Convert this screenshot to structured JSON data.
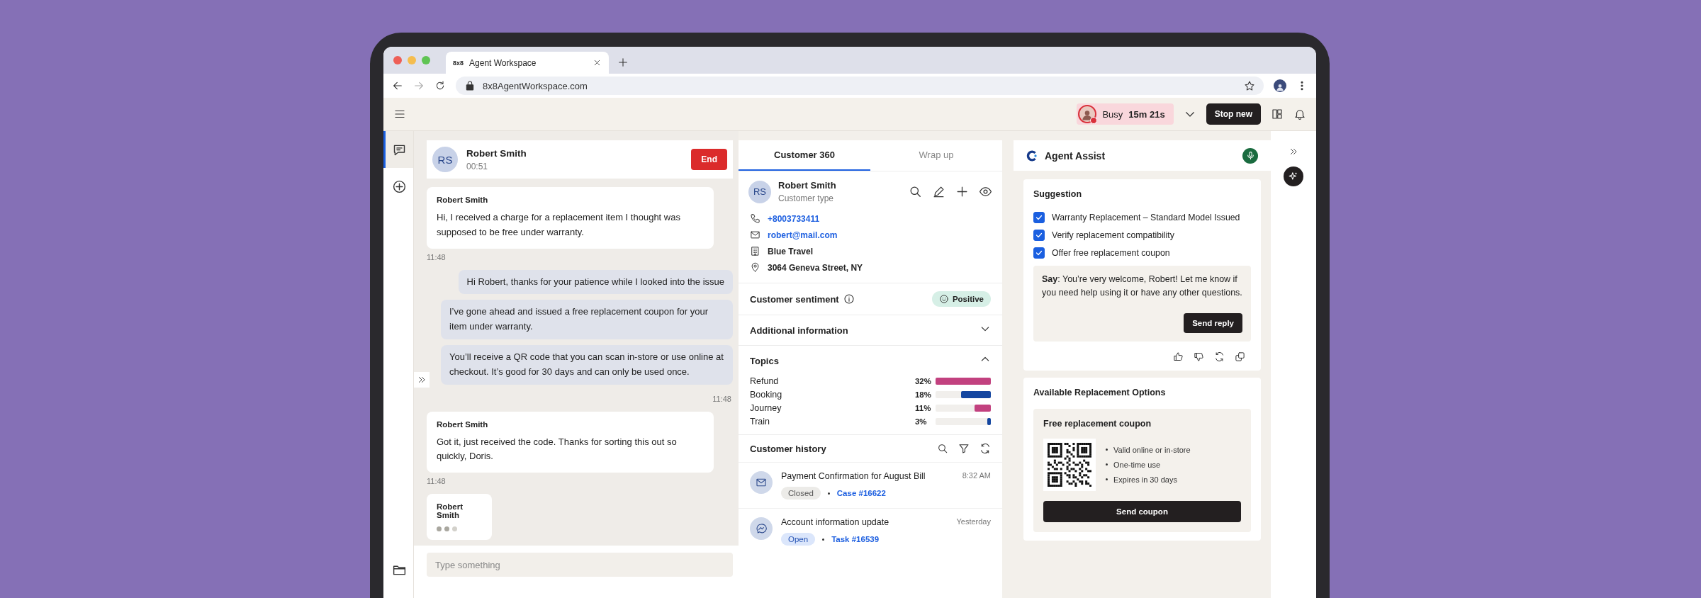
{
  "browser": {
    "tab": {
      "favicon_text": "8x8",
      "title": "Agent Workspace"
    },
    "url": "8x8AgentWorkspace.com"
  },
  "topbar": {
    "status": {
      "label": "Busy",
      "timer": "15m 21s"
    },
    "stop_button": "Stop new"
  },
  "nav": [
    {
      "kind": "chat",
      "selected": true
    },
    {
      "kind": "add",
      "selected": false
    },
    {
      "kind": "folder",
      "selected": false
    }
  ],
  "chat": {
    "contact": {
      "initials": "RS",
      "name": "Robert Smith",
      "duration": "00:51"
    },
    "end_button": "End",
    "messages": [
      {
        "kind": "incoming",
        "sender": "Robert Smith",
        "text": "Hi, I received a charge for a replacement item I thought was supposed to be free under warranty.",
        "time": "11:48"
      },
      {
        "kind": "outgoing",
        "text": "Hi Robert, thanks for your patience while I looked into the issue"
      },
      {
        "kind": "outgoing",
        "text": "I’ve gone ahead and issued a free replacement coupon for your item under warranty."
      },
      {
        "kind": "outgoing",
        "text": "You’ll receive a QR code that you can scan in-store or use online at checkout. It’s good for 30 days and can only be used once.",
        "time": "11:48"
      },
      {
        "kind": "incoming",
        "sender": "Robert Smith",
        "text": "Got it, just received the code. Thanks for sorting this out so quickly, Doris.",
        "time": "11:48"
      },
      {
        "kind": "typing",
        "sender": "Robert Smith"
      }
    ],
    "composer": {
      "placeholder": "Type something"
    }
  },
  "customer360": {
    "tabs": [
      {
        "label": "Customer 360",
        "selected": true
      },
      {
        "label": "Wrap up",
        "selected": false
      }
    ],
    "profile": {
      "initials": "RS",
      "name": "Robert Smith",
      "type": "Customer type"
    },
    "contacts": [
      {
        "kind": "phone",
        "text": "+8003733411"
      },
      {
        "kind": "email",
        "text": "robert@mail.com"
      },
      {
        "kind": "company",
        "text": "Blue Travel"
      },
      {
        "kind": "address",
        "text": "3064 Geneva Street, NY"
      }
    ],
    "sentiment": {
      "title": "Customer sentiment",
      "badge": "Positive"
    },
    "additional": {
      "title": "Additional information",
      "expanded": false
    },
    "topics": {
      "title": "Topics",
      "expanded": true,
      "items": [
        {
          "label": "Refund",
          "percent": "32%",
          "level": 1,
          "color": "#c2417f"
        },
        {
          "label": "Booking",
          "percent": "18%",
          "level": 0.54,
          "color": "#1446a0"
        },
        {
          "label": "Journey",
          "percent": "11%",
          "level": 0.3,
          "color": "#c2417f"
        },
        {
          "label": "Train",
          "percent": "3%",
          "level": 0.07,
          "color": "#1446a0"
        }
      ]
    },
    "history": {
      "title": "Customer history",
      "items": [
        {
          "kind": "email",
          "title": "Payment Confirmation for August Bill",
          "time": "8:32 AM",
          "status": "Closed",
          "resolved": true,
          "link": "Case #16622"
        },
        {
          "kind": "messenger",
          "title": "Account information update",
          "time": "Yesterday",
          "status": "Open",
          "resolved": false,
          "link": "Task #16539"
        }
      ]
    }
  },
  "agent_assist": {
    "title": "Agent Assist",
    "suggestion": {
      "title": "Suggestion",
      "checklist": [
        {
          "label": "Warranty Replacement – Standard Model Issued",
          "checked": true
        },
        {
          "label": "Verify replacement compatibility",
          "checked": true
        },
        {
          "label": "Offer free replacement coupon",
          "checked": true
        }
      ],
      "say": "**Say**: You’re very welcome, Robert! Let me know if you need help using it or have any other questions.",
      "button": "Send reply"
    },
    "options": {
      "title": "Available Replacement Options",
      "coupon": {
        "title": "Free replacement coupon",
        "bullets": [
          "Valid online or in-store",
          "One-time use",
          "Expires in 30 days"
        ],
        "button": "Send coupon"
      }
    }
  }
}
